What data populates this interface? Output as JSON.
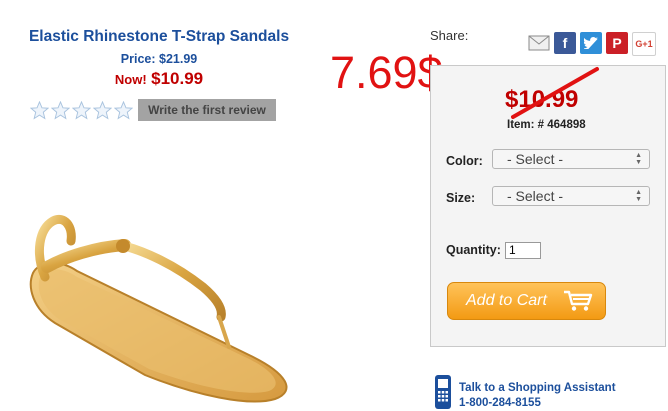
{
  "product": {
    "title": "Elastic Rhinestone T-Strap Sandals",
    "price_label": "Price:",
    "price": "$21.99",
    "now_label": "Now!",
    "now_price": "$10.99",
    "rating_stars": 0,
    "review_button": "Write the first review"
  },
  "promo_overlay": "7.69$",
  "share": {
    "label": "Share:",
    "icons": [
      "email-icon",
      "facebook-icon",
      "twitter-icon",
      "pinterest-icon",
      "google-plus-icon"
    ],
    "gplus_text": "G+1"
  },
  "purchase": {
    "old_price": "$10.99",
    "item_number": "Item: # 464898",
    "color_label": "Color:",
    "color_value": "- Select -",
    "size_label": "Size:",
    "size_value": "- Select -",
    "quantity_label": "Quantity:",
    "quantity_value": "1",
    "add_to_cart": "Add to Cart"
  },
  "assistant": {
    "text": "Talk to a Shopping Assistant",
    "phone": "1-800-284-8155"
  },
  "colors": {
    "title_blue": "#1c4f9c",
    "sale_red": "#c00000",
    "promo_red": "#e11212",
    "cart_orange": "#f39a13"
  }
}
